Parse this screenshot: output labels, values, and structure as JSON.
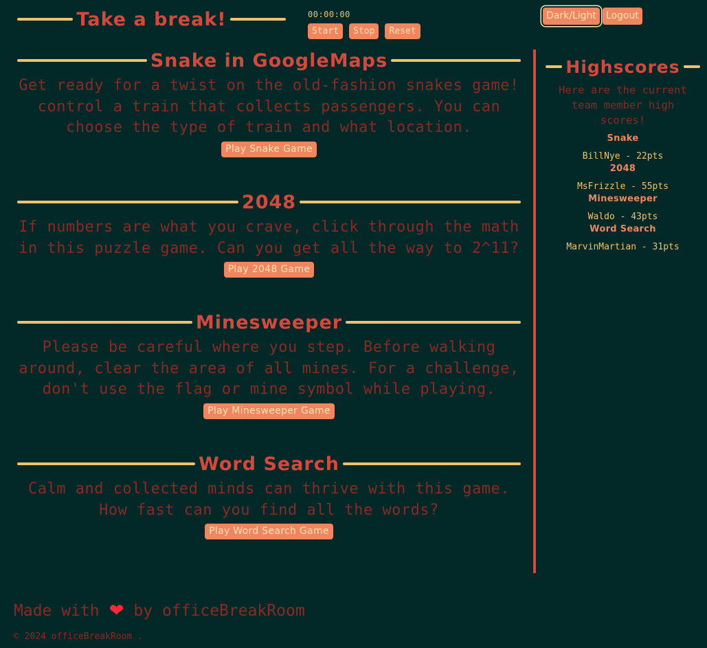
{
  "header": {
    "title": "Take a break!",
    "timer": "00:00:00",
    "start_label": "Start",
    "stop_label": "Stop",
    "reset_label": "Reset",
    "theme_toggle_label": "Dark/Light",
    "logout_label": "Logout"
  },
  "games": [
    {
      "title": "Snake in GoogleMaps",
      "description": "Get ready for a twist on the old-fashion snakes game! control a train that collects passengers. You can choose the type of train and what location.",
      "button_label": "Play Snake Game"
    },
    {
      "title": "2048",
      "description": "If numbers are what you crave, click through the math in this puzzle game. Can you get all the way to 2^11?",
      "button_label": "Play 2048 Game"
    },
    {
      "title": "Minesweeper",
      "description": "Please be careful where you step. Before walking around, clear the area of all mines. For a challenge, don't use the flag or mine symbol while playing.",
      "button_label": "Play Minesweeper Game"
    },
    {
      "title": "Word Search",
      "description": "Calm and collected minds can thrive with this game. How fast can you find all the words?",
      "button_label": "Play Word Search Game"
    }
  ],
  "highscores": {
    "title": "Highscores",
    "intro": "Here are the current team member high scores!",
    "entries": [
      {
        "game": "Snake",
        "score": "BillNye - 22pts"
      },
      {
        "game": "2048",
        "score": "MsFrizzle - 55pts"
      },
      {
        "game": "Minesweeper",
        "score": "Waldo - 43pts"
      },
      {
        "game": "Word Search",
        "score": "MarvinMartian - 31pts"
      }
    ]
  },
  "footer": {
    "made_with": "Made with",
    "by": "by officeBreakRoom",
    "heart_icon": "heart-icon",
    "copyright": "© 2024 officeBreakRoom ."
  },
  "colors": {
    "background": "#022927",
    "accent_red": "#d4493c",
    "line_yellow": "#f1c269",
    "button": "#f0865f",
    "muted_text": "#8a2a23"
  }
}
